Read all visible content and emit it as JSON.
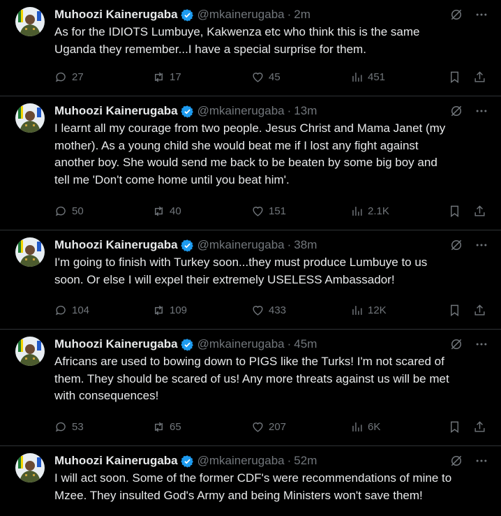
{
  "account": {
    "name": "Muhoozi Kainerugaba",
    "handle": "@mkainerugaba"
  },
  "colors": {
    "background": "#000000",
    "text": "#e7e9ea",
    "muted": "#71767b",
    "divider": "#2f3336",
    "verified": "#1d9bf0"
  },
  "tweets": [
    {
      "time": "2m",
      "text": "As for the IDIOTS Lumbuye, Kakwenza etc who think this is the same\nUganda they remember...I have a special surprise for them.",
      "replies": "27",
      "retweets": "17",
      "likes": "45",
      "views": "451"
    },
    {
      "time": "13m",
      "text": "I learnt all my courage from two people. Jesus Christ and Mama Janet (my\nmother). As a young child she would beat me if I lost any fight against\nanother boy. She would send me back to be beaten by some big boy and\ntell me 'Don't come home until you beat him'.",
      "replies": "50",
      "retweets": "40",
      "likes": "151",
      "views": "2.1K"
    },
    {
      "time": "38m",
      "text": "I'm going to finish with Turkey soon...they must produce Lumbuye to us\nsoon. Or else I will expel their extremely USELESS Ambassador!",
      "replies": "104",
      "retweets": "109",
      "likes": "433",
      "views": "12K"
    },
    {
      "time": "45m",
      "text": "Africans are used to bowing down to PIGS like the Turks! I'm not scared of\nthem. They should be scared of us! Any more threats against us will be met\nwith consequences!",
      "replies": "53",
      "retweets": "65",
      "likes": "207",
      "views": "6K"
    },
    {
      "time": "52m",
      "text": "I will act soon. Some of the former CDF's were recommendations of mine to\nMzee. They insulted God's Army and being Ministers won't save them!",
      "replies": "",
      "retweets": "",
      "likes": "",
      "views": ""
    }
  ],
  "icons": [
    "grok-icon",
    "more-icon",
    "reply-icon",
    "retweet-icon",
    "like-icon",
    "views-icon",
    "bookmark-icon",
    "share-icon",
    "verified-badge-icon"
  ]
}
